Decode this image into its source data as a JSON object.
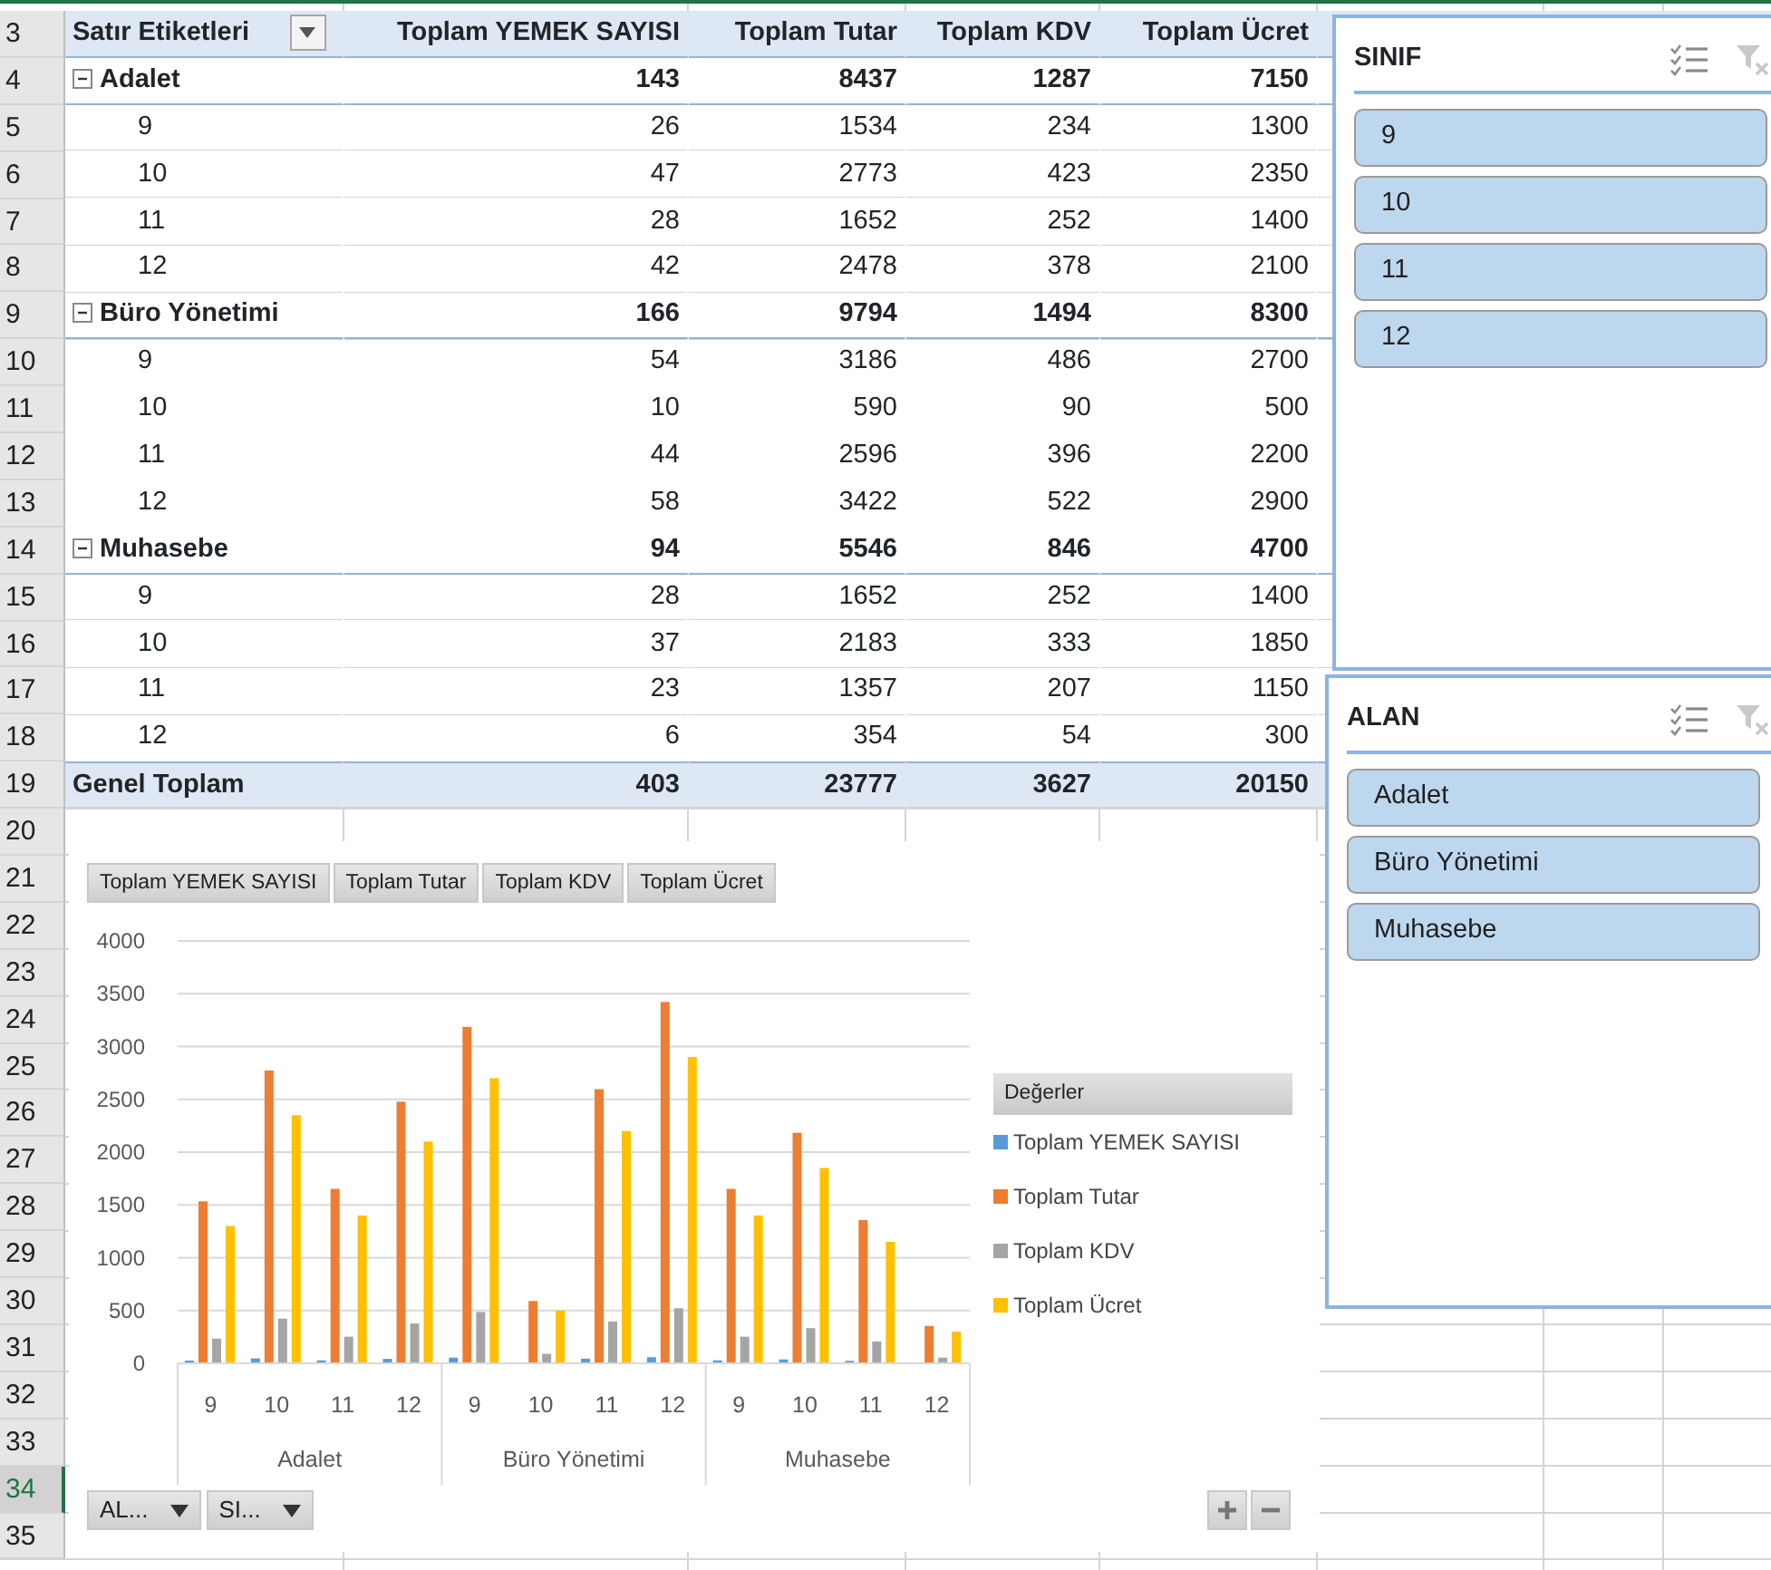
{
  "sheet": {
    "rows": [
      {
        "number": "3",
        "selected": false
      },
      {
        "number": "4",
        "selected": false
      },
      {
        "number": "5",
        "selected": false
      },
      {
        "number": "6",
        "selected": false
      },
      {
        "number": "7",
        "selected": false
      },
      {
        "number": "8",
        "selected": false
      },
      {
        "number": "9",
        "selected": false
      },
      {
        "number": "10",
        "selected": false
      },
      {
        "number": "11",
        "selected": false
      },
      {
        "number": "12",
        "selected": false
      },
      {
        "number": "13",
        "selected": false
      },
      {
        "number": "14",
        "selected": false
      },
      {
        "number": "15",
        "selected": false
      },
      {
        "number": "16",
        "selected": false
      },
      {
        "number": "17",
        "selected": false
      },
      {
        "number": "18",
        "selected": false
      },
      {
        "number": "19",
        "selected": false
      },
      {
        "number": "20",
        "selected": false
      },
      {
        "number": "21",
        "selected": false
      },
      {
        "number": "22",
        "selected": false
      },
      {
        "number": "23",
        "selected": false
      },
      {
        "number": "24",
        "selected": false
      },
      {
        "number": "25",
        "selected": false
      },
      {
        "number": "26",
        "selected": false
      },
      {
        "number": "27",
        "selected": false
      },
      {
        "number": "28",
        "selected": false
      },
      {
        "number": "29",
        "selected": false
      },
      {
        "number": "30",
        "selected": false
      },
      {
        "number": "31",
        "selected": false
      },
      {
        "number": "32",
        "selected": false
      },
      {
        "number": "33",
        "selected": false
      },
      {
        "number": "34",
        "selected": true
      },
      {
        "number": "35",
        "selected": false
      }
    ]
  },
  "pivot": {
    "row_label_header": "Satır Etiketleri",
    "columns": [
      "Toplam YEMEK SAYISI",
      "Toplam Tutar",
      "Toplam KDV",
      "Toplam Ücret"
    ],
    "groups": [
      {
        "label": "Adalet",
        "expanded": true,
        "values": [
          "143",
          "8437",
          "1287",
          "7150"
        ],
        "children": [
          {
            "label": "9",
            "values": [
              "26",
              "1534",
              "234",
              "1300"
            ]
          },
          {
            "label": "10",
            "values": [
              "47",
              "2773",
              "423",
              "2350"
            ]
          },
          {
            "label": "11",
            "values": [
              "28",
              "1652",
              "252",
              "1400"
            ]
          },
          {
            "label": "12",
            "values": [
              "42",
              "2478",
              "378",
              "2100"
            ]
          }
        ]
      },
      {
        "label": "Büro Yönetimi",
        "expanded": true,
        "values": [
          "166",
          "9794",
          "1494",
          "8300"
        ],
        "children": [
          {
            "label": "9",
            "values": [
              "54",
              "3186",
              "486",
              "2700"
            ]
          },
          {
            "label": "10",
            "values": [
              "10",
              "590",
              "90",
              "500"
            ]
          },
          {
            "label": "11",
            "values": [
              "44",
              "2596",
              "396",
              "2200"
            ]
          },
          {
            "label": "12",
            "values": [
              "58",
              "3422",
              "522",
              "2900"
            ]
          }
        ]
      },
      {
        "label": "Muhasebe",
        "expanded": true,
        "values": [
          "94",
          "5546",
          "846",
          "4700"
        ],
        "children": [
          {
            "label": "9",
            "values": [
              "28",
              "1652",
              "252",
              "1400"
            ]
          },
          {
            "label": "10",
            "values": [
              "37",
              "2183",
              "333",
              "1850"
            ]
          },
          {
            "label": "11",
            "values": [
              "23",
              "1357",
              "207",
              "1150"
            ]
          },
          {
            "label": "12",
            "values": [
              "6",
              "354",
              "54",
              "300"
            ]
          }
        ]
      }
    ],
    "total": {
      "label": "Genel Toplam",
      "values": [
        "403",
        "23777",
        "3627",
        "20150"
      ]
    }
  },
  "chart": {
    "field_buttons": [
      "Toplam YEMEK SAYISI",
      "Toplam Tutar",
      "Toplam KDV",
      "Toplam Ücret"
    ],
    "legend_title": "Değerler",
    "axis_filters": [
      "AL...",
      "SI..."
    ],
    "category_groups": [
      "Adalet",
      "Büro Yönetimi",
      "Muhasebe"
    ],
    "chart_data": {
      "type": "bar",
      "grid": true,
      "legend": true,
      "categories": [
        "9",
        "10",
        "11",
        "12",
        "9",
        "10",
        "11",
        "12",
        "9",
        "10",
        "11",
        "12"
      ],
      "ylim": [
        0,
        4000
      ],
      "yticks": [
        0,
        500,
        1000,
        1500,
        2000,
        2500,
        3000,
        3500,
        4000
      ],
      "series": [
        {
          "name": "Toplam YEMEK SAYISI",
          "color": "#5b9bd5",
          "values": [
            26,
            47,
            28,
            42,
            54,
            10,
            44,
            58,
            28,
            37,
            23,
            6
          ]
        },
        {
          "name": "Toplam Tutar",
          "color": "#ed7d31",
          "values": [
            1534,
            2773,
            1652,
            2478,
            3186,
            590,
            2596,
            3422,
            1652,
            2183,
            1357,
            354
          ]
        },
        {
          "name": "Toplam KDV",
          "color": "#a5a5a5",
          "values": [
            234,
            423,
            252,
            378,
            486,
            90,
            396,
            522,
            252,
            333,
            207,
            54
          ]
        },
        {
          "name": "Toplam Ücret",
          "color": "#ffc000",
          "values": [
            1300,
            2350,
            1400,
            2100,
            2700,
            500,
            2200,
            2900,
            1400,
            1850,
            1150,
            300
          ]
        }
      ]
    }
  },
  "slicers": [
    {
      "title": "SINIF",
      "items": [
        {
          "label": "9",
          "selected": true
        },
        {
          "label": "10",
          "selected": true
        },
        {
          "label": "11",
          "selected": true
        },
        {
          "label": "12",
          "selected": true
        }
      ]
    },
    {
      "title": "ALAN",
      "items": [
        {
          "label": "Adalet",
          "selected": true
        },
        {
          "label": "Büro Yönetimi",
          "selected": true
        },
        {
          "label": "Muhasebe",
          "selected": true
        }
      ]
    }
  ]
}
